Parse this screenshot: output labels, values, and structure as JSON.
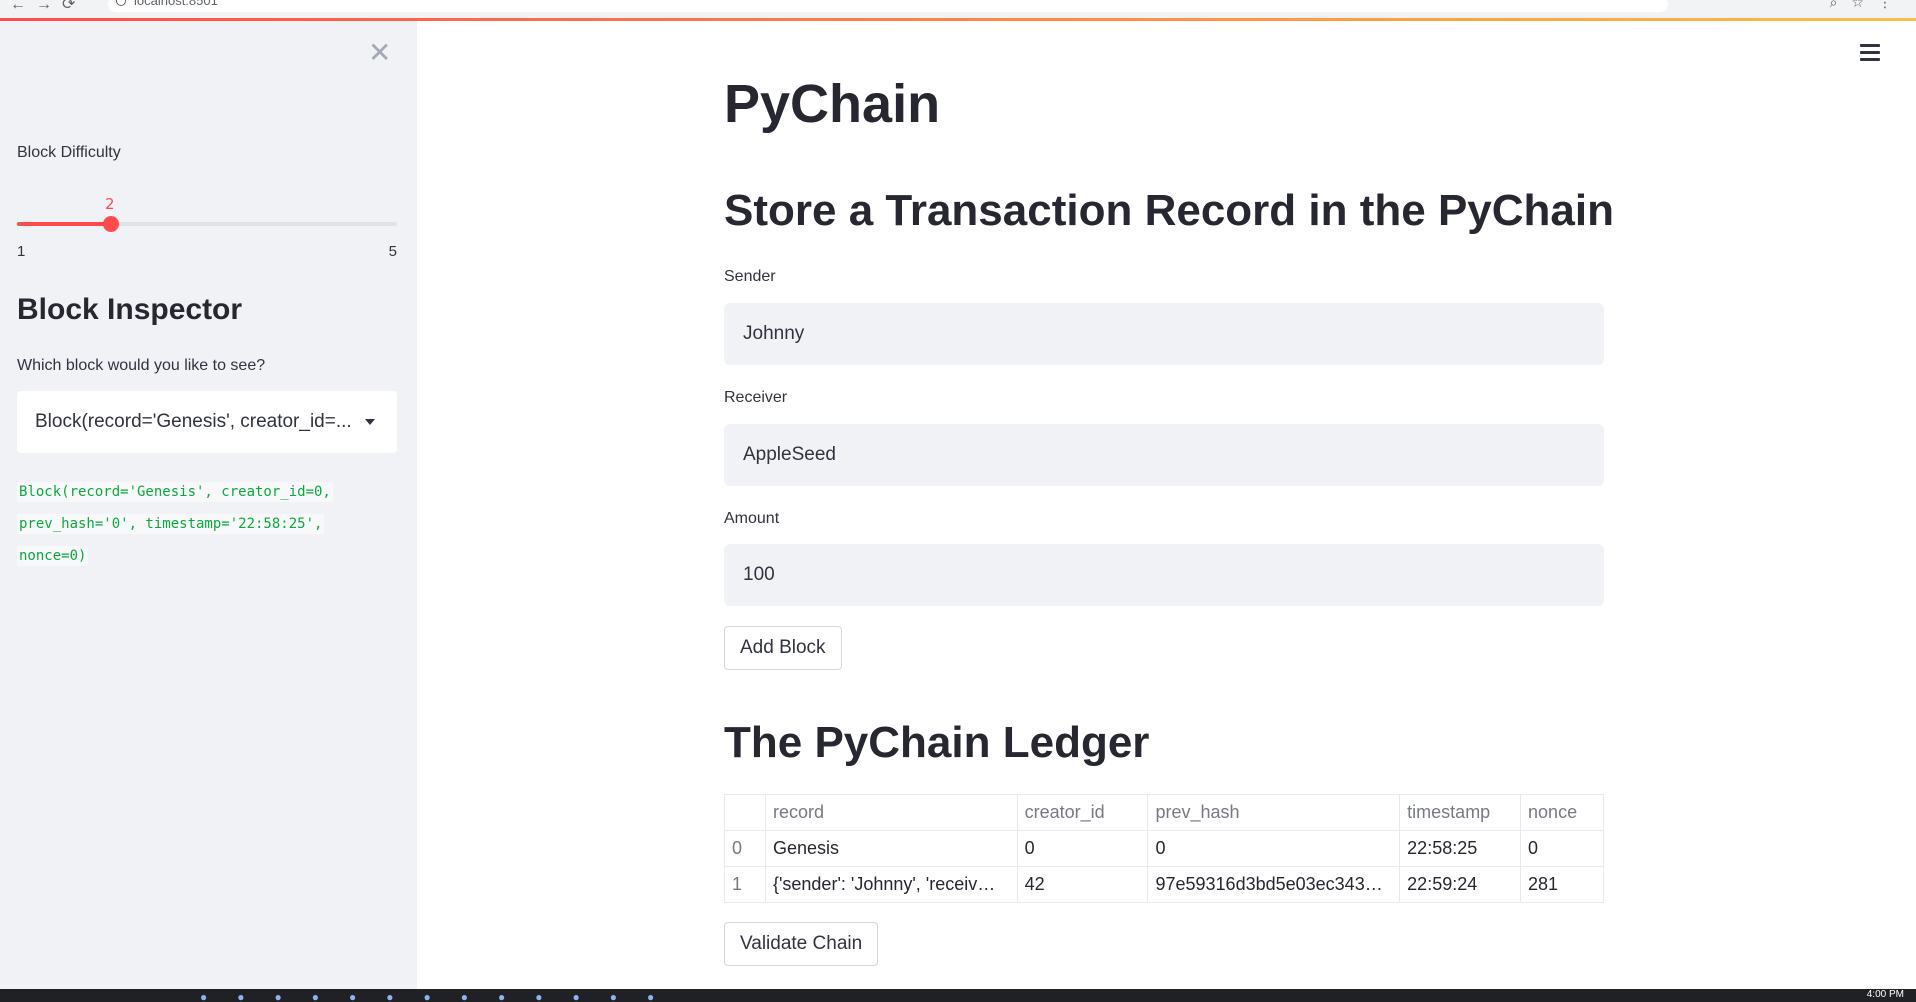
{
  "browser": {
    "url": "localhost:8501"
  },
  "sidebar": {
    "close_icon": "close-icon",
    "slider": {
      "label": "Block Difficulty",
      "value": "2",
      "min": "1",
      "max": "5",
      "color": "#ff4b4b"
    },
    "inspector": {
      "heading": "Block Inspector",
      "select_label": "Which block would you like to see?",
      "selected_value": "Block(record='Genesis', creator_id=...",
      "code_lines": [
        "Block(record='Genesis', creator_id=0,",
        "prev_hash='0', timestamp='22:58:25',",
        "nonce=0)"
      ]
    }
  },
  "main": {
    "title": "PyChain",
    "form_heading": "Store a Transaction Record in the PyChain",
    "sender": {
      "label": "Sender",
      "value": "Johnny"
    },
    "receiver": {
      "label": "Receiver",
      "value": "AppleSeed"
    },
    "amount": {
      "label": "Amount",
      "value": "100"
    },
    "add_block_label": "Add Block",
    "ledger_heading": "The PyChain Ledger",
    "ledger": {
      "columns": [
        "",
        "record",
        "creator_id",
        "prev_hash",
        "timestamp",
        "nonce"
      ],
      "rows": [
        [
          "0",
          "Genesis",
          "0",
          "0",
          "22:58:25",
          "0"
        ],
        [
          "1",
          "{'sender': 'Johnny', 'receiv…",
          "42",
          "97e59316d3bd5e03ec343…",
          "22:59:24",
          "281"
        ]
      ]
    },
    "validate_label": "Validate Chain"
  },
  "taskbar": {
    "clock": "4:00 PM"
  }
}
